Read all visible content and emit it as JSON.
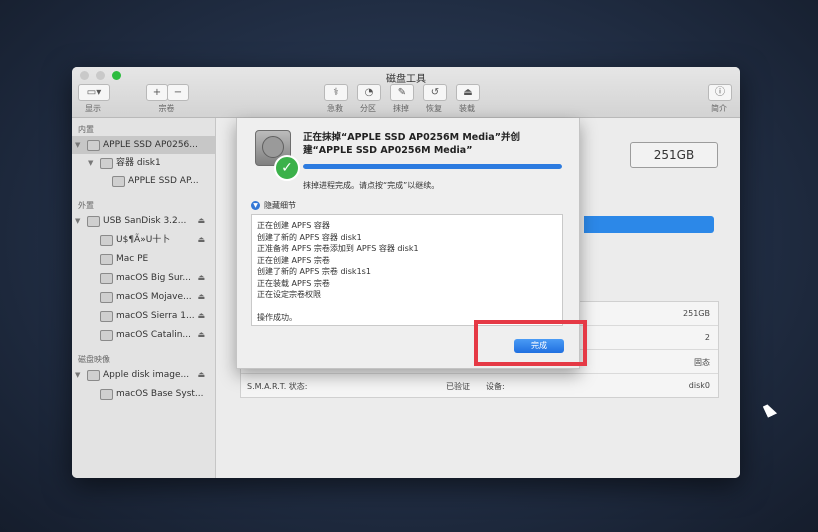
{
  "window": {
    "title": "磁盘工具",
    "toolbar": {
      "view_label": "显示",
      "volume_label": "宗卷",
      "add_symbol": "+",
      "remove_symbol": "−",
      "tools": [
        {
          "label": "急救",
          "icon": "stethoscope-icon"
        },
        {
          "label": "分区",
          "icon": "partition-icon"
        },
        {
          "label": "抹掉",
          "icon": "erase-icon"
        },
        {
          "label": "恢复",
          "icon": "restore-icon"
        },
        {
          "label": "装载",
          "icon": "mount-icon"
        }
      ],
      "info_label": "简介"
    }
  },
  "sidebar": {
    "internal_label": "内置",
    "external_label": "外置",
    "images_label": "磁盘映像",
    "internal": [
      {
        "label": "APPLE SSD AP0256...",
        "selected": true
      },
      {
        "label": "容器 disk1"
      },
      {
        "label": "APPLE SSD AP..."
      }
    ],
    "external": [
      {
        "label": "USB SanDisk 3.2..."
      },
      {
        "label": "U$¶Ã»U十卜"
      },
      {
        "label": "Mac PE"
      },
      {
        "label": "macOS Big Sur..."
      },
      {
        "label": "macOS Mojave..."
      },
      {
        "label": "macOS Sierra 1..."
      },
      {
        "label": "macOS Catalin..."
      }
    ],
    "images": [
      {
        "label": "Apple disk image..."
      },
      {
        "label": "macOS Base Syst..."
      }
    ]
  },
  "main": {
    "capacity": "251GB",
    "info_rows": [
      {
        "left_label": "",
        "left_value": "",
        "right_label": "",
        "right_value": "251GB"
      },
      {
        "left_label": "",
        "left_value": "",
        "right_label": "",
        "right_value": "2"
      },
      {
        "left_label": "",
        "left_value": "",
        "right_label": "",
        "right_value": "固态"
      },
      {
        "left_label": "S.M.A.R.T. 状态:",
        "left_value": "已验证",
        "right_label": "设备:",
        "right_value": "disk0"
      }
    ]
  },
  "sheet": {
    "title": "正在抹掉“APPLE SSD AP0256M Media”并创建“APPLE SSD AP0256M Media”",
    "progress": 1.0,
    "status": "抹掉进程完成。请点按“完成”以继续。",
    "details_toggle": "隐藏细节",
    "log": [
      "正在创建 APFS 容器",
      "创建了新的 APFS 容器 disk1",
      "正准备将 APFS 宗卷添加到 APFS 容器 disk1",
      "正在创建 APFS 宗卷",
      "创建了新的 APFS 宗卷 disk1s1",
      "正在装载 APFS 宗卷",
      "正在设定宗卷权限",
      "",
      "操作成功。"
    ],
    "done_button": "完成",
    "check_symbol": "✓"
  },
  "colors": {
    "accent": "#2c7be0",
    "highlight": "#e53945",
    "success": "#3bb14a"
  }
}
